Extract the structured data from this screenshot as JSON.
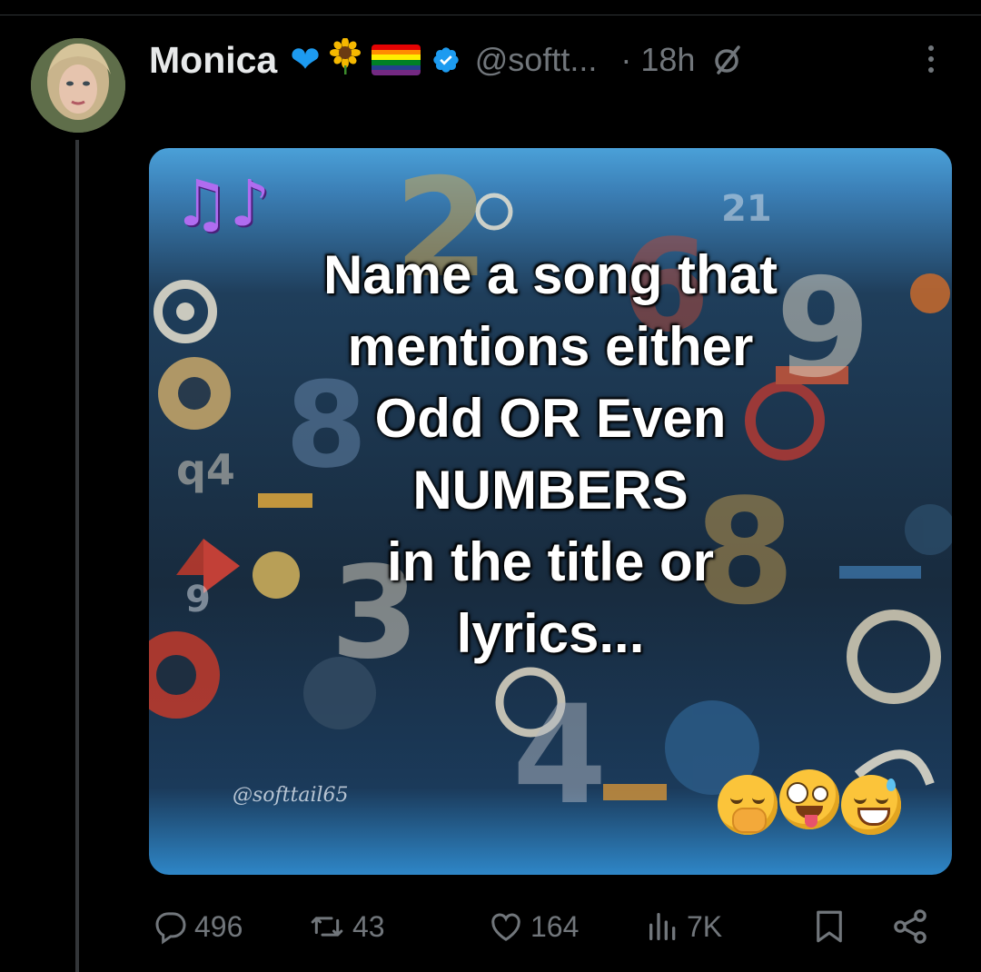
{
  "post": {
    "author": {
      "name": "Monica",
      "badges": [
        "blue-heart",
        "sunflower",
        "rainbow-flag",
        "verified-badge"
      ],
      "handle": "@softt...",
      "time": "· 18h"
    },
    "image": {
      "caption_lines": [
        "Name a song that",
        "mentions either",
        "Odd OR Even",
        "NUMBERS",
        "in the title or",
        "lyrics..."
      ],
      "watermark": "@softtail65",
      "emojis": [
        "hand-over-mouth-emoji",
        "zany-face-emoji",
        "grinning-sweat-emoji"
      ]
    },
    "stats": {
      "replies": "496",
      "reposts": "43",
      "likes": "164",
      "views": "7K"
    }
  },
  "colors": {
    "background": "#000000",
    "text_primary": "#e7e9ea",
    "text_secondary": "#71767b",
    "verified_blue": "#1d9bf0"
  }
}
